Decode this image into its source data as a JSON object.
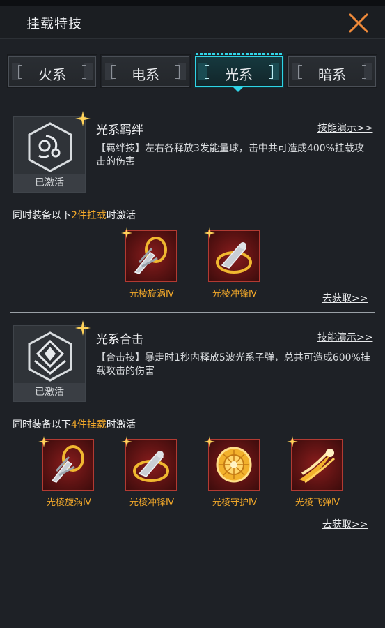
{
  "header": {
    "title": "挂载特技"
  },
  "tabs": [
    {
      "label": "火系",
      "active": false
    },
    {
      "label": "电系",
      "active": false
    },
    {
      "label": "光系",
      "active": true
    },
    {
      "label": "暗系",
      "active": false
    }
  ],
  "skills": [
    {
      "name": "光系羁绊",
      "status": "已激活",
      "demo_link": "技能演示>>",
      "description": "【羁绊技】左右各释放3发能量球，击中共可造成400%挂载攻击的伤害",
      "requirement": {
        "prefix": "同时装备以下",
        "highlight": "2件挂载",
        "suffix": "时激活"
      },
      "items": [
        {
          "name": "光棱旋涡Ⅳ",
          "icon": "vortex-icon"
        },
        {
          "name": "光棱冲锋Ⅳ",
          "icon": "charge-icon"
        }
      ],
      "obtain_link": "去获取>>"
    },
    {
      "name": "光系合击",
      "status": "已激活",
      "demo_link": "技能演示>>",
      "description": "【合击技】暴走时1秒内释放5波光系子弹，总共可造成600%挂载攻击的伤害",
      "requirement": {
        "prefix": "同时装备以下",
        "highlight": "4件挂载",
        "suffix": "时激活"
      },
      "items": [
        {
          "name": "光棱旋涡Ⅳ",
          "icon": "vortex-icon"
        },
        {
          "name": "光棱冲锋Ⅳ",
          "icon": "charge-icon"
        },
        {
          "name": "光棱守护Ⅳ",
          "icon": "guard-icon"
        },
        {
          "name": "光棱飞弹Ⅳ",
          "icon": "missile-icon"
        }
      ],
      "obtain_link": "去获取>>"
    }
  ],
  "colors": {
    "accent": "#30d5e8",
    "highlight": "#f0a72a",
    "background": "#1e2126"
  }
}
